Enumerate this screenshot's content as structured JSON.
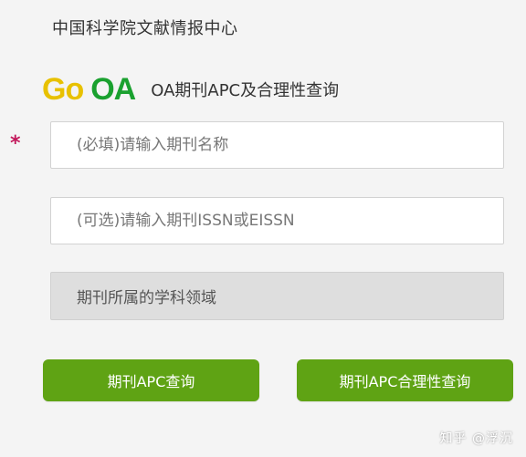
{
  "header": {
    "organization": "中国科学院文献情报中心"
  },
  "brand": {
    "logo_go": "Go",
    "logo_oa": "OA",
    "subtitle": "OA期刊APC及合理性查询"
  },
  "form": {
    "required_mark": "*",
    "journal_name_placeholder": "(必填)请输入期刊名称",
    "issn_placeholder": "(可选)请输入期刊ISSN或EISSN",
    "discipline_select_value": "期刊所属的学科领域"
  },
  "actions": {
    "apc_query_label": "期刊APC查询",
    "apc_reasonableness_label": "期刊APC合理性查询"
  },
  "watermark": "知乎 @浮沉",
  "colors": {
    "background": "#f4f4f4",
    "button_green": "#5fa314",
    "logo_yellow": "#e8c100",
    "logo_green": "#1aa12f",
    "required_red": "#c2185b",
    "select_bg": "#dedede"
  }
}
